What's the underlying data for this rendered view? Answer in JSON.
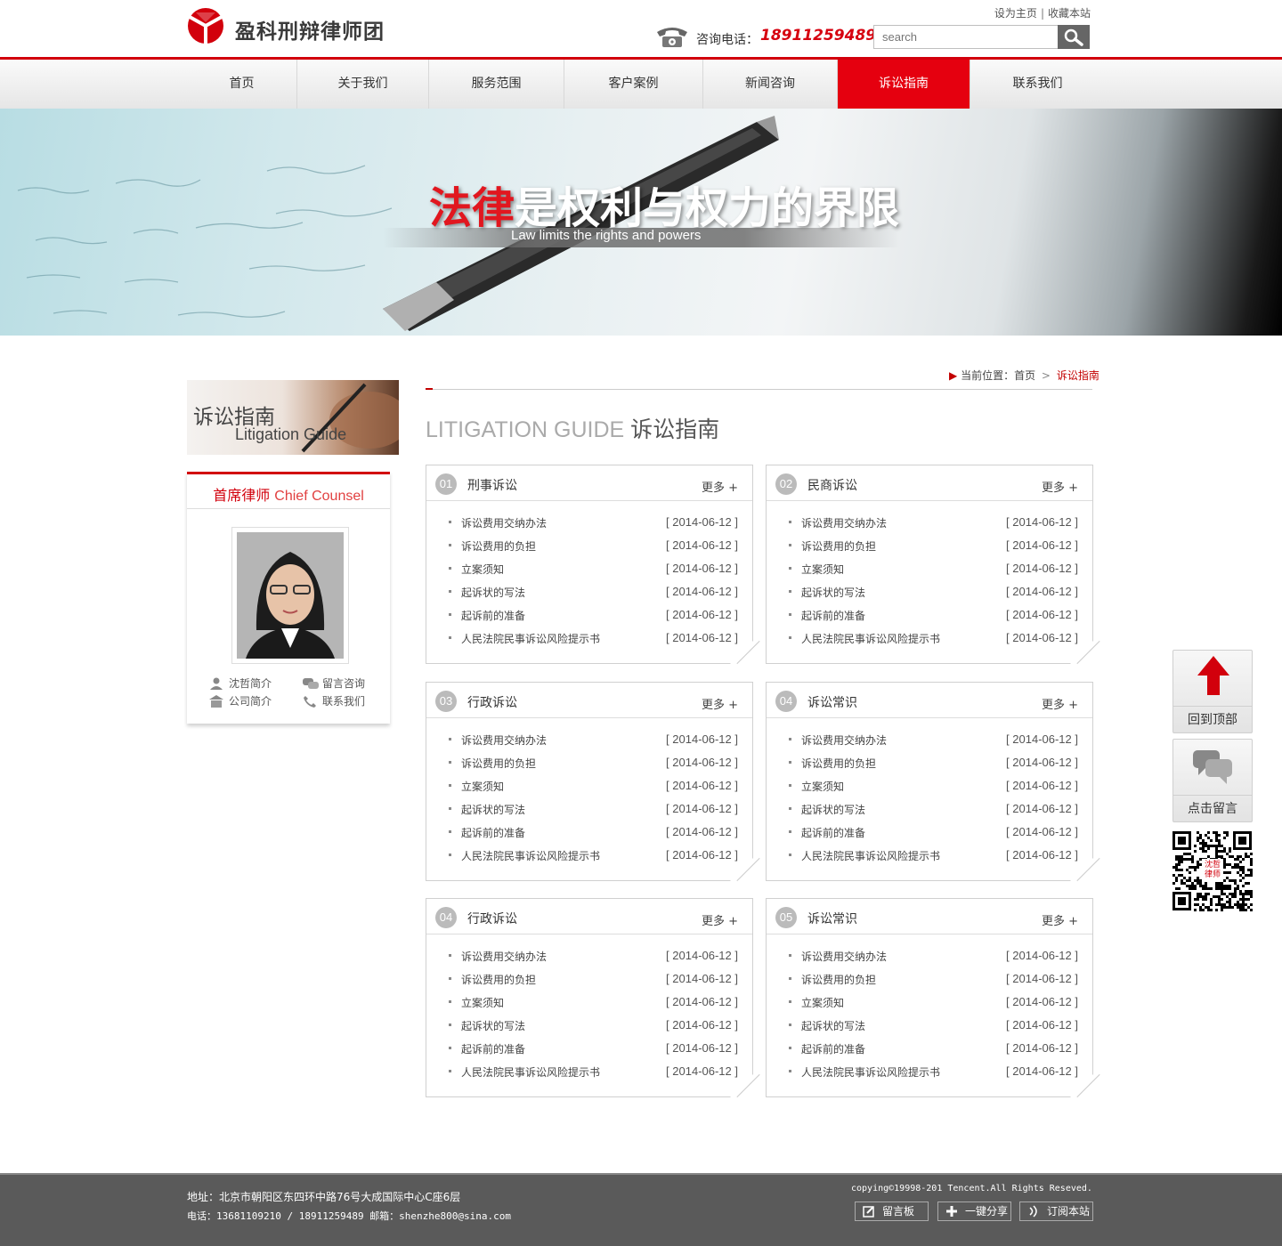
{
  "header": {
    "brand_name": "盈科刑辩律师团",
    "top_links": [
      "设为主页",
      "收藏本站"
    ],
    "phone_label": "咨询电话：",
    "phone_number": "18911259489",
    "search_placeholder": "search"
  },
  "nav": {
    "items": [
      "首页",
      "关于我们",
      "服务范围",
      "客户案例",
      "新闻咨询",
      "诉讼指南",
      "联系我们"
    ],
    "active": "诉讼指南"
  },
  "banner": {
    "title_highlight": "法律",
    "title_rest": "是权利与权力的界限",
    "subtitle": "Law limits the rights and powers"
  },
  "breadcrumb": {
    "label": "当前位置：",
    "home": "首页",
    "separator": ">",
    "current": "诉讼指南"
  },
  "page_title": {
    "en": "LITIGATION GUIDE",
    "cn": "诉讼指南"
  },
  "sidebar": {
    "banner_cn": "诉讼指南",
    "banner_en": "Litigation Guide",
    "counsel_title_cn": "首席律师",
    "counsel_title_en": "Chief Counsel",
    "links": [
      "沈哲简介",
      "留言咨询",
      "公司简介",
      "联系我们"
    ]
  },
  "more_label": "更多 +",
  "panels": [
    {
      "num": "01",
      "title": "刑事诉讼",
      "items": [
        {
          "title": "诉讼费用交纳办法",
          "date": "[ 2014-06-12 ]"
        },
        {
          "title": "诉讼费用的负担",
          "date": "[ 2014-06-12 ]"
        },
        {
          "title": "立案须知",
          "date": "[ 2014-06-12 ]"
        },
        {
          "title": "起诉状的写法",
          "date": "[ 2014-06-12 ]"
        },
        {
          "title": "起诉前的准备",
          "date": "[ 2014-06-12 ]"
        },
        {
          "title": "人民法院民事诉讼风险提示书",
          "date": "[ 2014-06-12 ]"
        }
      ]
    },
    {
      "num": "02",
      "title": "民商诉讼",
      "items": [
        {
          "title": "诉讼费用交纳办法",
          "date": "[ 2014-06-12 ]"
        },
        {
          "title": "诉讼费用的负担",
          "date": "[ 2014-06-12 ]"
        },
        {
          "title": "立案须知",
          "date": "[ 2014-06-12 ]"
        },
        {
          "title": "起诉状的写法",
          "date": "[ 2014-06-12 ]"
        },
        {
          "title": "起诉前的准备",
          "date": "[ 2014-06-12 ]"
        },
        {
          "title": "人民法院民事诉讼风险提示书",
          "date": "[ 2014-06-12 ]"
        }
      ]
    },
    {
      "num": "03",
      "title": "行政诉讼",
      "items": [
        {
          "title": "诉讼费用交纳办法",
          "date": "[ 2014-06-12 ]"
        },
        {
          "title": "诉讼费用的负担",
          "date": "[ 2014-06-12 ]"
        },
        {
          "title": "立案须知",
          "date": "[ 2014-06-12 ]"
        },
        {
          "title": "起诉状的写法",
          "date": "[ 2014-06-12 ]"
        },
        {
          "title": "起诉前的准备",
          "date": "[ 2014-06-12 ]"
        },
        {
          "title": "人民法院民事诉讼风险提示书",
          "date": "[ 2014-06-12 ]"
        }
      ]
    },
    {
      "num": "04",
      "title": "诉讼常识",
      "items": [
        {
          "title": "诉讼费用交纳办法",
          "date": "[ 2014-06-12 ]"
        },
        {
          "title": "诉讼费用的负担",
          "date": "[ 2014-06-12 ]"
        },
        {
          "title": "立案须知",
          "date": "[ 2014-06-12 ]"
        },
        {
          "title": "起诉状的写法",
          "date": "[ 2014-06-12 ]"
        },
        {
          "title": "起诉前的准备",
          "date": "[ 2014-06-12 ]"
        },
        {
          "title": "人民法院民事诉讼风险提示书",
          "date": "[ 2014-06-12 ]"
        }
      ]
    },
    {
      "num": "04",
      "title": "行政诉讼",
      "items": [
        {
          "title": "诉讼费用交纳办法",
          "date": "[ 2014-06-12 ]"
        },
        {
          "title": "诉讼费用的负担",
          "date": "[ 2014-06-12 ]"
        },
        {
          "title": "立案须知",
          "date": "[ 2014-06-12 ]"
        },
        {
          "title": "起诉状的写法",
          "date": "[ 2014-06-12 ]"
        },
        {
          "title": "起诉前的准备",
          "date": "[ 2014-06-12 ]"
        },
        {
          "title": "人民法院民事诉讼风险提示书",
          "date": "[ 2014-06-12 ]"
        }
      ]
    },
    {
      "num": "05",
      "title": "诉讼常识",
      "items": [
        {
          "title": "诉讼费用交纳办法",
          "date": "[ 2014-06-12 ]"
        },
        {
          "title": "诉讼费用的负担",
          "date": "[ 2014-06-12 ]"
        },
        {
          "title": "立案须知",
          "date": "[ 2014-06-12 ]"
        },
        {
          "title": "起诉状的写法",
          "date": "[ 2014-06-12 ]"
        },
        {
          "title": "起诉前的准备",
          "date": "[ 2014-06-12 ]"
        },
        {
          "title": "人民法院民事诉讼风险提示书",
          "date": "[ 2014-06-12 ]"
        }
      ]
    }
  ],
  "float_tools": {
    "back_to_top": "回到顶部",
    "leave_message": "点击留言",
    "qr_text": "沈哲律师"
  },
  "footer": {
    "address": "地址：北京市朝阳区东四环中路76号大成国际中心C座6层",
    "phone_email": "电话：13681109210 / 18911259489  邮箱：shenzhe800@sina.com",
    "copyright": "copying©19998-201 Tencent.All Rights Reseved.",
    "buttons": [
      "留言板",
      "一键分享",
      "订阅本站"
    ]
  },
  "colors": {
    "brand_red": "#d2000c",
    "nav_active": "#e5000f",
    "footer_bg": "#5a5a5a"
  }
}
